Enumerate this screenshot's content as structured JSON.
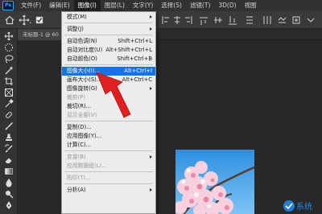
{
  "app": {
    "logo_text": "Ps"
  },
  "menubar": {
    "items": [
      {
        "id": "file",
        "label": "文件(F)"
      },
      {
        "id": "edit",
        "label": "编辑(E)"
      },
      {
        "id": "image",
        "label": "图像(I)"
      },
      {
        "id": "layer",
        "label": "图层(L)"
      },
      {
        "id": "text",
        "label": "文字(Y)"
      },
      {
        "id": "select",
        "label": "选择(S)"
      },
      {
        "id": "filter",
        "label": "滤镜(T)"
      },
      {
        "id": "3d",
        "label": "3D(D)"
      },
      {
        "id": "view",
        "label": "视图"
      }
    ],
    "active": "image"
  },
  "document": {
    "tab_label": "未标题-1 @ 60"
  },
  "image_menu": {
    "items": [
      {
        "label": "模式(M)",
        "shortcut": "",
        "submenu": true,
        "disabled": false
      },
      {
        "separator": true
      },
      {
        "label": "调整(J)",
        "shortcut": "",
        "submenu": true,
        "disabled": false
      },
      {
        "separator": true
      },
      {
        "label": "自动色调(N)",
        "shortcut": "Shift+Ctrl+L",
        "submenu": false,
        "disabled": false
      },
      {
        "label": "自动对比度(U)",
        "shortcut": "Alt+Shift+Ctrl+L",
        "submenu": false,
        "disabled": false
      },
      {
        "label": "自动颜色(O)",
        "shortcut": "Shift+Ctrl+B",
        "submenu": false,
        "disabled": false
      },
      {
        "separator": true
      },
      {
        "label": "图像大小(I)...",
        "shortcut": "Alt+Ctrl+I",
        "submenu": false,
        "disabled": false,
        "highlighted": true
      },
      {
        "label": "画布大小(S)...",
        "shortcut": "Alt+Ctrl+C",
        "submenu": false,
        "disabled": false
      },
      {
        "label": "图像旋转(G)",
        "shortcut": "",
        "submenu": true,
        "disabled": false
      },
      {
        "label": "裁剪(P)",
        "shortcut": "",
        "submenu": false,
        "disabled": true
      },
      {
        "label": "裁切(R)...",
        "shortcut": "",
        "submenu": false,
        "disabled": false
      },
      {
        "label": "显示全部(V)",
        "shortcut": "",
        "submenu": false,
        "disabled": true
      },
      {
        "separator": true
      },
      {
        "label": "复制(D)...",
        "shortcut": "",
        "submenu": false,
        "disabled": false
      },
      {
        "label": "应用图像(Y)...",
        "shortcut": "",
        "submenu": false,
        "disabled": false
      },
      {
        "label": "计算(C)...",
        "shortcut": "",
        "submenu": false,
        "disabled": false
      },
      {
        "separator": true
      },
      {
        "label": "变量(B)",
        "shortcut": "",
        "submenu": true,
        "disabled": true
      },
      {
        "label": "应用数据组(L)...",
        "shortcut": "",
        "submenu": false,
        "disabled": true
      },
      {
        "separator": true
      },
      {
        "label": "陷印(T)...",
        "shortcut": "",
        "submenu": false,
        "disabled": true
      },
      {
        "separator": true
      },
      {
        "label": "分析(A)",
        "shortcut": "",
        "submenu": true,
        "disabled": false
      }
    ]
  },
  "watermark": {
    "text": "系统"
  },
  "colors": {
    "menu_highlight": "#1473e6",
    "arrow_red": "#e02020",
    "menubar_bg": "#323232",
    "dropdown_bg": "#ececec"
  }
}
